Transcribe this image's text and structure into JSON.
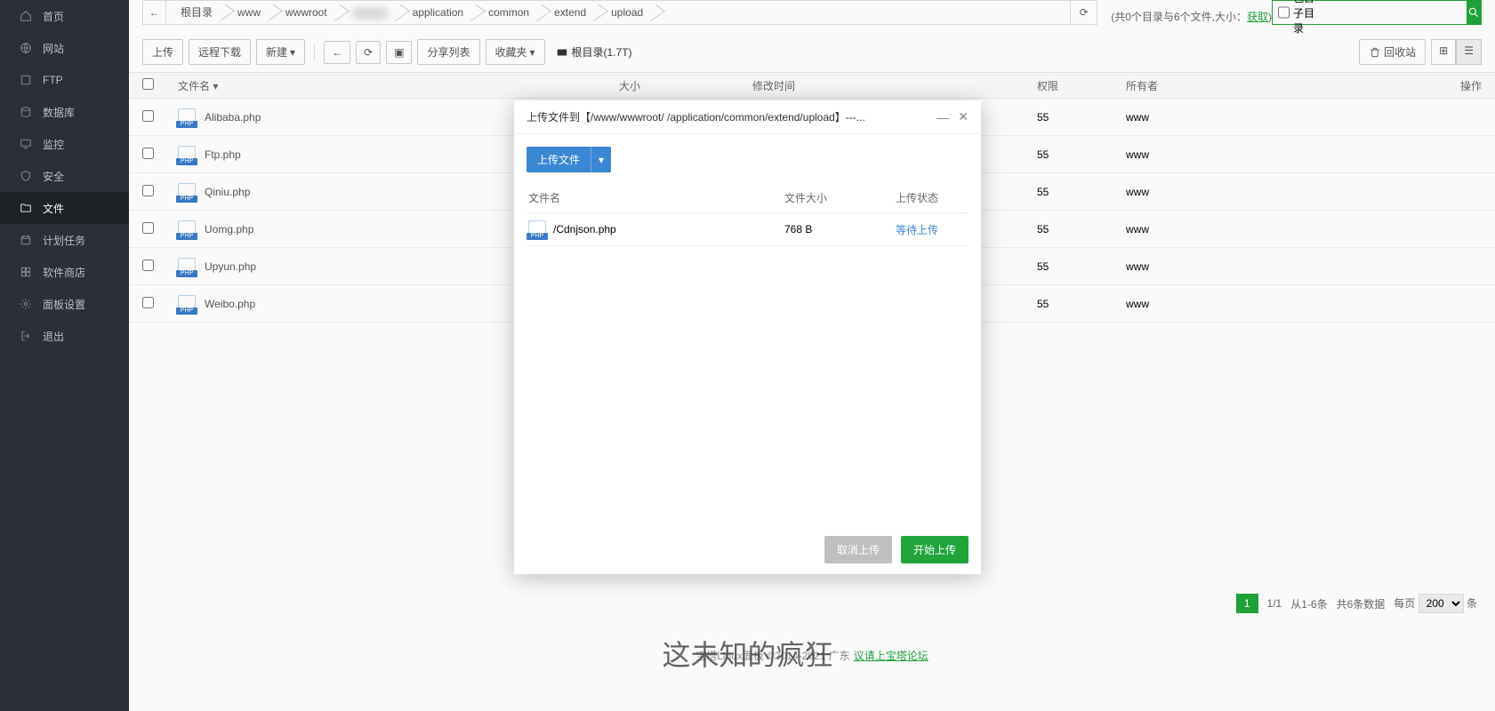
{
  "sidebar": [
    {
      "key": "home",
      "label": "首页"
    },
    {
      "key": "site",
      "label": "网站"
    },
    {
      "key": "ftp",
      "label": "FTP"
    },
    {
      "key": "db",
      "label": "数据库"
    },
    {
      "key": "monitor",
      "label": "监控"
    },
    {
      "key": "security",
      "label": "安全"
    },
    {
      "key": "file",
      "label": "文件",
      "active": true
    },
    {
      "key": "cron",
      "label": "计划任务"
    },
    {
      "key": "store",
      "label": "软件商店"
    },
    {
      "key": "panel",
      "label": "面板设置"
    },
    {
      "key": "logout",
      "label": "退出"
    }
  ],
  "breadcrumb": [
    "根目录",
    "www",
    "wwwroot",
    "",
    "application",
    "common",
    "extend",
    "upload"
  ],
  "topinfo_prefix": "(共0个目录与6个文件,大小：",
  "topinfo_link": "获取",
  "topinfo_suffix": ")",
  "search": {
    "checkbox_label": "包含子目录",
    "placeholder": ""
  },
  "toolbar": {
    "upload": "上传",
    "remote": "远程下载",
    "create": "新建",
    "share": "分享列表",
    "fav": "收藏夹",
    "rootinfo": "根目录(1.7T)",
    "trash": "回收站"
  },
  "columns": {
    "name": "文件名",
    "size": "大小",
    "time": "修改时间",
    "perm": "权限",
    "owner": "所有者",
    "op": "操作"
  },
  "files": [
    {
      "name": "Alibaba.php",
      "perm": "55",
      "owner": "www"
    },
    {
      "name": "Ftp.php",
      "perm": "55",
      "owner": "www"
    },
    {
      "name": "Qiniu.php",
      "perm": "55",
      "owner": "www"
    },
    {
      "name": "Uomg.php",
      "perm": "55",
      "owner": "www"
    },
    {
      "name": "Upyun.php",
      "perm": "55",
      "owner": "www"
    },
    {
      "name": "Weibo.php",
      "perm": "55",
      "owner": "www"
    }
  ],
  "pagination": {
    "page": "1",
    "pages": "1/1",
    "range": "从1-6条",
    "total": "共6条数据",
    "perlabel": "每页",
    "per": "200",
    "unit": "条"
  },
  "footer": {
    "text_a": "宝塔Linux面板 ©2014-2021 广东",
    "text_b": "议请上宝塔论坛"
  },
  "watermark": "这未知的疯狂",
  "modal": {
    "title": "上传文件到【/www/wwwroot/      /application/common/extend/upload】---...",
    "upload_btn": "上传文件",
    "cols": {
      "name": "文件名",
      "size": "文件大小",
      "status": "上传状态"
    },
    "rows": [
      {
        "name": "/Cdnjson.php",
        "size": "768 B",
        "status": "等待上传"
      }
    ],
    "cancel": "取消上传",
    "start": "开始上传"
  }
}
